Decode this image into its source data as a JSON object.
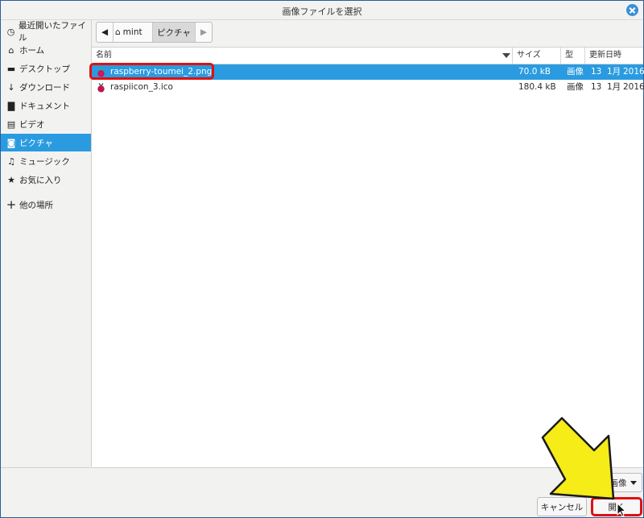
{
  "window": {
    "title": "画像ファイルを選択"
  },
  "sidebar": {
    "items": [
      {
        "icon": "clock-icon",
        "label": "最近開いたファイル"
      },
      {
        "icon": "home-icon",
        "label": "ホーム"
      },
      {
        "icon": "desktop-icon",
        "label": "デスクトップ"
      },
      {
        "icon": "download-icon",
        "label": "ダウンロード"
      },
      {
        "icon": "document-icon",
        "label": "ドキュメント"
      },
      {
        "icon": "video-icon",
        "label": "ビデオ"
      },
      {
        "icon": "camera-icon",
        "label": "ピクチャ"
      },
      {
        "icon": "music-icon",
        "label": "ミュージック"
      },
      {
        "icon": "star-icon",
        "label": "お気に入り"
      },
      {
        "icon": "plus-icon",
        "label": "他の場所"
      }
    ],
    "active": "ピクチャ"
  },
  "pathbar": {
    "segments": [
      "mint",
      "ピクチャ"
    ]
  },
  "columns": {
    "name": "名前",
    "size": "サイズ",
    "type": "型",
    "modified": "更新日時"
  },
  "files": [
    {
      "name": "raspberry-toumei_2.png",
      "size": "70.0 kB",
      "type": "画像",
      "day": "13",
      "month": "1月",
      "year": "2016",
      "selected": true
    },
    {
      "name": "raspiicon_3.ico",
      "size": "180.4 kB",
      "type": "画像",
      "day": "13",
      "month": "1月",
      "year": "2016",
      "selected": false
    }
  ],
  "filter": {
    "label": "画像"
  },
  "buttons": {
    "cancel": "キャンセル",
    "open": "開く"
  },
  "colors": {
    "selection": "#2a9be0",
    "highlight": "#e01010",
    "arrow": "#f5ec18"
  }
}
